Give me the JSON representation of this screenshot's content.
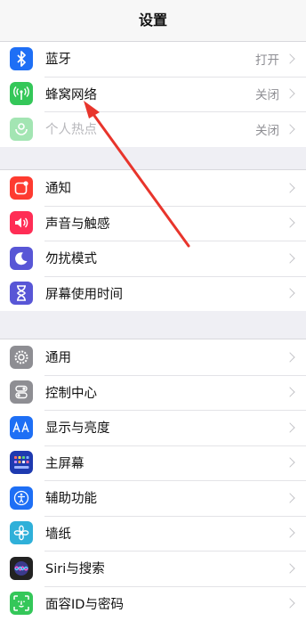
{
  "header": {
    "title": "设置"
  },
  "groups": [
    {
      "items": [
        {
          "label": "蓝牙",
          "value": "打开",
          "icon": "bluetooth-icon",
          "color": "#1e6ff5"
        },
        {
          "label": "蜂窝网络",
          "value": "关闭",
          "icon": "cellular-icon",
          "color": "#34c759"
        },
        {
          "label": "个人热点",
          "value": "关闭",
          "icon": "hotspot-icon",
          "color": "#34c759"
        }
      ]
    },
    {
      "items": [
        {
          "label": "通知",
          "icon": "notifications-icon",
          "color": "#fe3b30"
        },
        {
          "label": "声音与触感",
          "icon": "sounds-icon",
          "color": "#ff2d55"
        },
        {
          "label": "勿扰模式",
          "icon": "moon-icon",
          "color": "#5856d6"
        },
        {
          "label": "屏幕使用时间",
          "icon": "hourglass-icon",
          "color": "#5856d6"
        }
      ]
    },
    {
      "items": [
        {
          "label": "通用",
          "icon": "gear-icon",
          "color": "#8e8e93"
        },
        {
          "label": "控制中心",
          "icon": "control-center-icon",
          "color": "#8e8e93"
        },
        {
          "label": "显示与亮度",
          "icon": "display-icon",
          "color": "#1e6ff5"
        },
        {
          "label": "主屏幕",
          "icon": "home-screen-icon",
          "color": "#1e3ab0"
        },
        {
          "label": "辅助功能",
          "icon": "accessibility-icon",
          "color": "#1e6ff5"
        },
        {
          "label": "墙纸",
          "icon": "wallpaper-icon",
          "color": "#2fb0d9"
        },
        {
          "label": "Siri与搜索",
          "icon": "siri-icon",
          "color": "#222222"
        },
        {
          "label": "面容ID与密码",
          "icon": "face-id-icon",
          "color": "#34c759"
        }
      ]
    }
  ],
  "annotation": {
    "arrow_color": "#e8352c"
  }
}
